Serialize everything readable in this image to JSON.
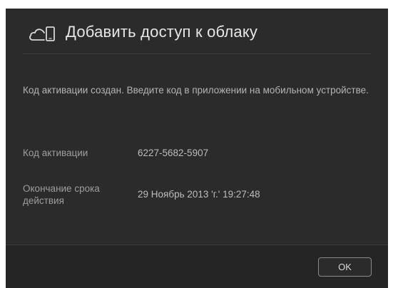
{
  "dialog": {
    "title": "Добавить доступ к облаку",
    "title_icon": "cloud-device-icon",
    "message": "Код активации создан. Введите код в приложении на мобильном устройстве.",
    "activation_code_label": "Код активации",
    "activation_code_value": "6227-5682-5907",
    "expiration_label": "Окончание срока действия",
    "expiration_value": "29 Ноябрь 2013 'г.' 19:27:48",
    "ok_label": "OK"
  },
  "colors": {
    "dialog_background": "#2b2b2b",
    "title_text": "#e6e6e6",
    "body_text": "#b4b4b4"
  }
}
